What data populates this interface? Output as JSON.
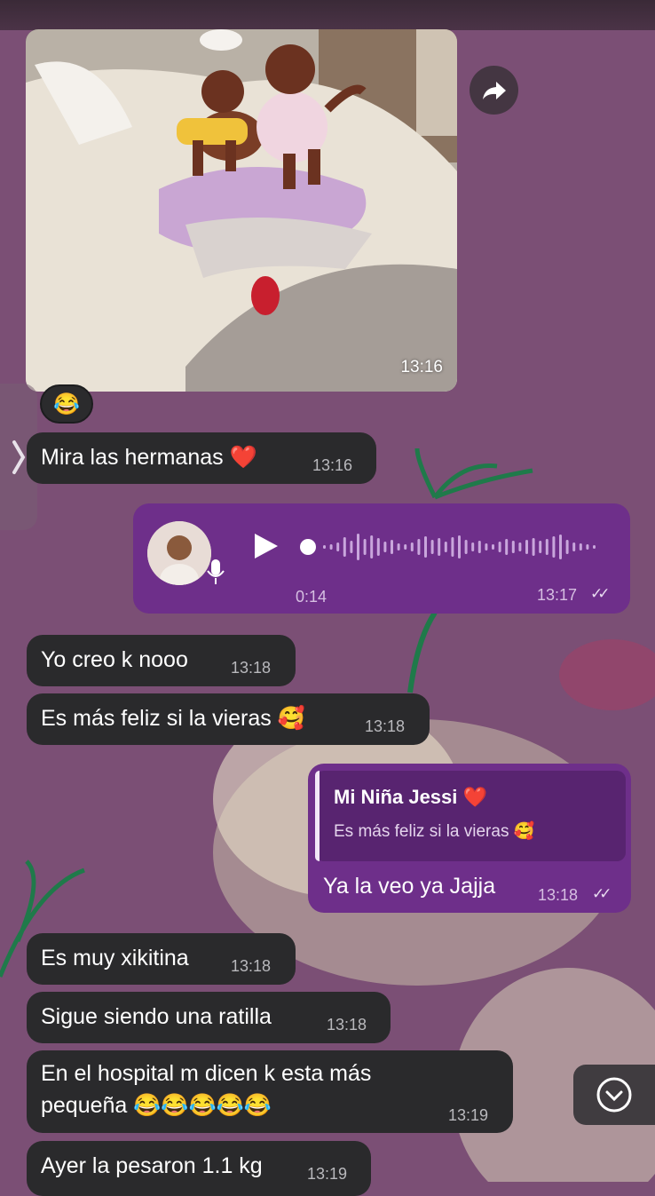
{
  "colors": {
    "chat_background": "#7b4f75",
    "incoming_bubble": "#2a2a2c",
    "outgoing_bubble": "#6e2f8a",
    "reply_quote_bg": "#582470"
  },
  "icons": {
    "forward": "forward-arrow-icon",
    "side_tab": "chevron-right-icon",
    "play": "play-icon",
    "mic": "microphone-icon",
    "scroll_down": "chevron-down-circle-icon",
    "read_receipt": "double-check-icon"
  },
  "photo_message": {
    "time": "13:16",
    "reaction": "😂"
  },
  "messages": [
    {
      "id": "m1",
      "direction": "incoming",
      "text": "Mira las hermanas",
      "emoji": "❤️",
      "time": "13:16"
    },
    {
      "id": "voice",
      "direction": "outgoing",
      "type": "voice",
      "duration": "0:14",
      "time": "13:17",
      "checks": "✓✓"
    },
    {
      "id": "m2",
      "direction": "incoming",
      "text": "Yo creo k nooo",
      "time": "13:18"
    },
    {
      "id": "m3",
      "direction": "incoming",
      "text": "Es más feliz si la vieras",
      "emoji": "🥰",
      "time": "13:18"
    },
    {
      "id": "reply",
      "direction": "outgoing",
      "text": "Ya la veo ya Jajja",
      "time": "13:18",
      "checks": "✓✓",
      "quote": {
        "name": "Mi Niña Jessi",
        "name_emoji": "❤️",
        "text": "Es más feliz si la vieras",
        "text_emoji": "🥰"
      }
    },
    {
      "id": "m4",
      "direction": "incoming",
      "text": "Es muy xikitina",
      "time": "13:18"
    },
    {
      "id": "m5",
      "direction": "incoming",
      "text": "Sigue siendo una ratilla",
      "time": "13:18"
    },
    {
      "id": "m6",
      "direction": "incoming",
      "line1": "En el hospital m dicen k esta más",
      "line2": "pequeña",
      "emoji": "😂😂😂😂😂",
      "time": "13:19"
    },
    {
      "id": "m7",
      "direction": "incoming",
      "text": "Ayer la pesaron 1.1 kg",
      "time": "13:19"
    }
  ]
}
